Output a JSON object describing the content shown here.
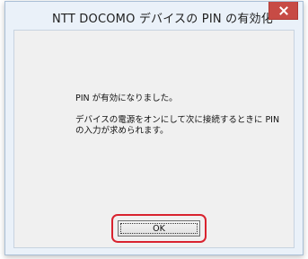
{
  "window": {
    "title": "NTT DOCOMO デバイスの PIN の有効化",
    "close_icon": "close-x-icon",
    "close_color": "#c74b45"
  },
  "dialog": {
    "message_1": "PIN が有効になりました。",
    "message_2": "デバイスの電源をオンにして次に接続するときに PIN の入力が求められます。",
    "ok_label": "OK",
    "highlight_color": "#d9232f"
  }
}
